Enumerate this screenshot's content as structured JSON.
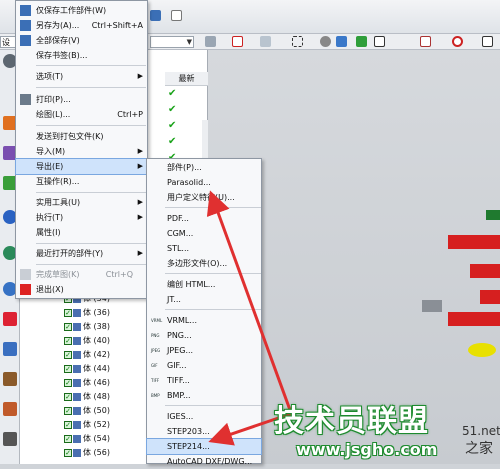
{
  "colors": {
    "accent": "#cfe3fb",
    "check": "#1aa31a",
    "arrow": "#e03030",
    "watermark": "#1e8b2f"
  },
  "toolbar": {
    "combo_prefix": "设"
  },
  "navigator": {
    "column_header": "最新",
    "features": [
      {
        "label": "体 (34)"
      },
      {
        "label": "体 (36)"
      },
      {
        "label": "体 (38)"
      },
      {
        "label": "体 (40)"
      },
      {
        "label": "体 (42)"
      },
      {
        "label": "体 (44)"
      },
      {
        "label": "体 (46)"
      },
      {
        "label": "体 (48)"
      },
      {
        "label": "体 (50)"
      },
      {
        "label": "体 (52)"
      },
      {
        "label": "体 (54)"
      },
      {
        "label": "体 (56)"
      }
    ]
  },
  "file_menu": {
    "items": [
      {
        "label": "仅保存工作部件(W)",
        "icon": "save-work-icon"
      },
      {
        "label": "另存为(A)...",
        "shortcut": "Ctrl+Shift+A",
        "icon": "save-as-icon"
      },
      {
        "label": "全部保存(V)",
        "icon": "save-all-icon"
      },
      {
        "label": "保存书签(B)..."
      },
      {
        "label": "选项(T)"
      },
      {
        "label": "打印(P)...",
        "icon": "print-icon"
      },
      {
        "label": "绘图(L)...",
        "shortcut": "Ctrl+P"
      },
      {
        "label": "发送到打包文件(K)"
      },
      {
        "label": "导入(M)"
      },
      {
        "label": "导出(E)"
      },
      {
        "label": "互操作(R)..."
      },
      {
        "label": "实用工具(U)"
      },
      {
        "label": "执行(T)"
      },
      {
        "label": "属性(I)"
      },
      {
        "label": "最近打开的部件(Y)"
      },
      {
        "label": "完成草图(K)",
        "shortcut": "Ctrl+Q"
      },
      {
        "label": "退出(X)",
        "icon": "exit-icon"
      }
    ]
  },
  "export_menu": {
    "items": [
      {
        "label": "部件(P)..."
      },
      {
        "label": "Parasolid..."
      },
      {
        "label": "用户定义特征(U)..."
      },
      {
        "label": "PDF..."
      },
      {
        "label": "CGM..."
      },
      {
        "label": "STL..."
      },
      {
        "label": "多边形文件(O)..."
      },
      {
        "label": "编创 HTML..."
      },
      {
        "label": "JT..."
      },
      {
        "label": "VRML...",
        "icon_text": "VRML"
      },
      {
        "label": "PNG...",
        "icon_text": "PNG"
      },
      {
        "label": "JPEG...",
        "icon_text": "JPEG"
      },
      {
        "label": "GIF...",
        "icon_text": "GIF"
      },
      {
        "label": "TIFF...",
        "icon_text": "TIFF"
      },
      {
        "label": "BMP...",
        "icon_text": "BMP"
      },
      {
        "label": "IGES..."
      },
      {
        "label": "STEP203..."
      },
      {
        "label": "STEP214..."
      },
      {
        "label": "AutoCAD DXF/DWG..."
      }
    ]
  },
  "watermark": {
    "main": "技术员联盟",
    "url": "www.jsgho.com",
    "side1": "51.net",
    "side2": "之家"
  }
}
